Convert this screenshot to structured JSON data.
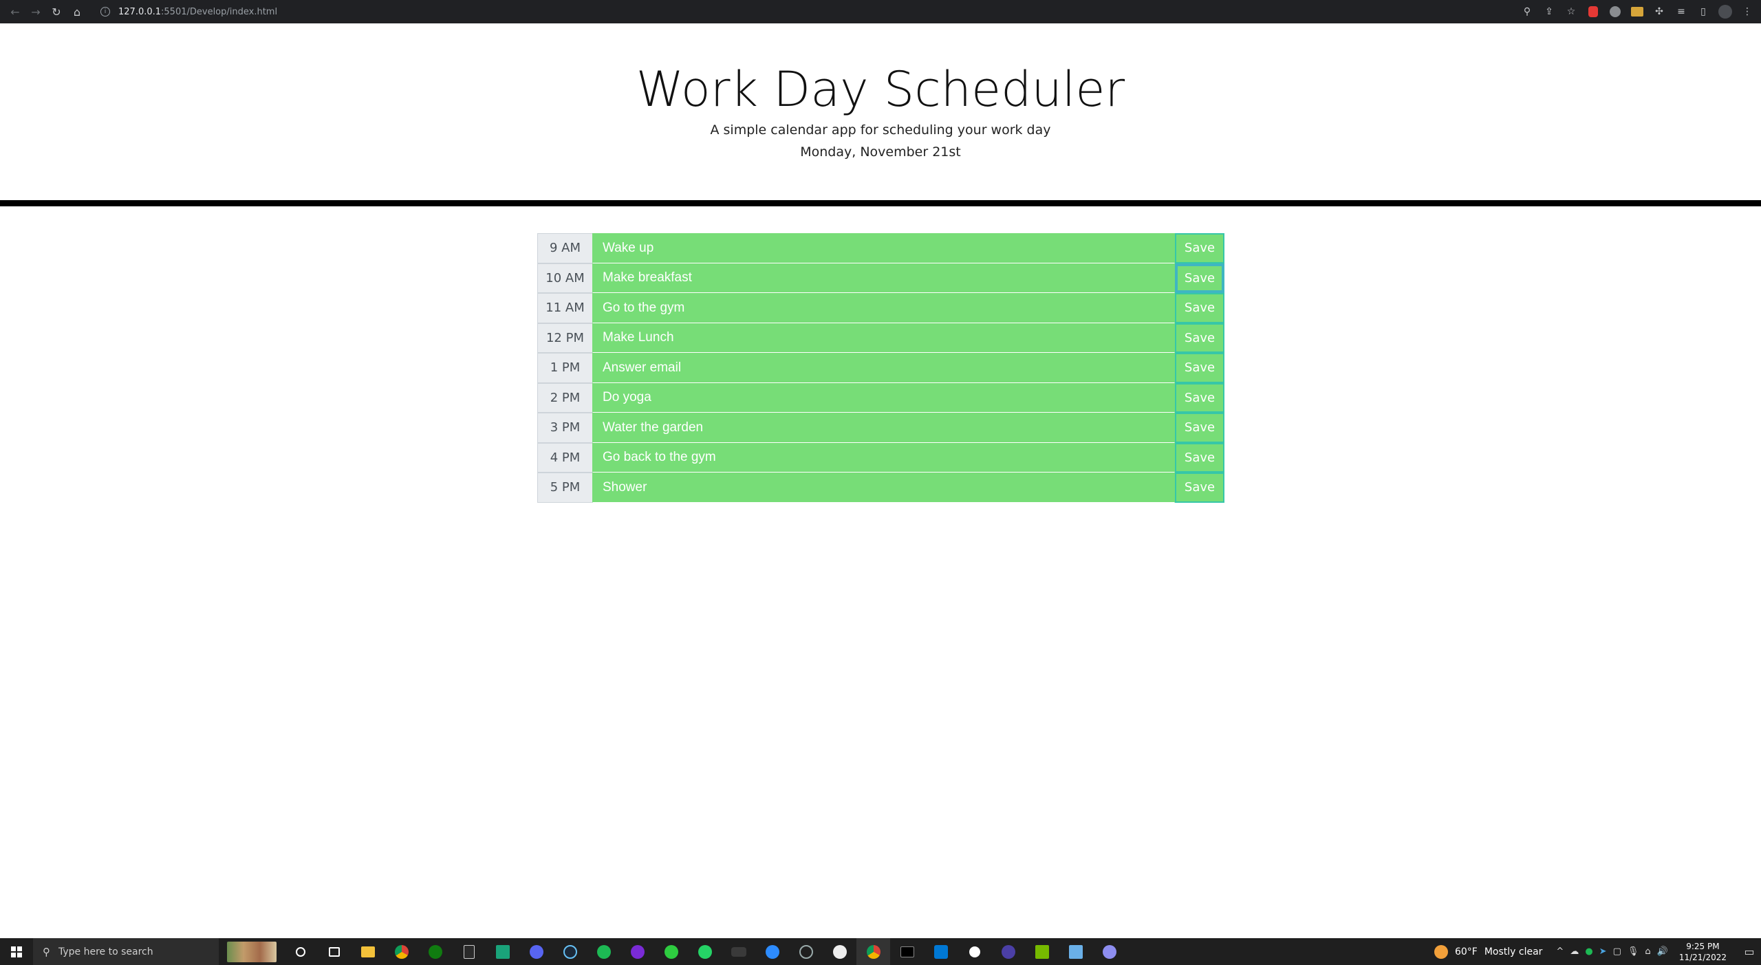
{
  "browser": {
    "url_host": "127.0.0.1",
    "url_rest": ":5501/Develop/index.html"
  },
  "header": {
    "title": "Work Day Scheduler",
    "lead": "A simple calendar app for scheduling your work day",
    "current_day": "Monday, November 21st"
  },
  "schedule": {
    "save_label": "Save",
    "rows": [
      {
        "hour": "9 AM",
        "task": "Wake up"
      },
      {
        "hour": "10 AM",
        "task": "Make breakfast"
      },
      {
        "hour": "11 AM",
        "task": "Go to the gym"
      },
      {
        "hour": "12 PM",
        "task": "Make Lunch"
      },
      {
        "hour": "1 PM",
        "task": "Answer email"
      },
      {
        "hour": "2 PM",
        "task": "Do yoga"
      },
      {
        "hour": "3 PM",
        "task": "Water the garden"
      },
      {
        "hour": "4 PM",
        "task": "Go back to the gym"
      },
      {
        "hour": "5 PM",
        "task": "Shower"
      }
    ]
  },
  "colors": {
    "future": "#77dd77",
    "save_border": "#36c7a8",
    "hour_bg": "#e9ecef"
  },
  "taskbar": {
    "search_placeholder": "Type here to search",
    "weather_temp": "60°F",
    "weather_desc": "Mostly clear",
    "time": "9:25 PM",
    "date": "11/21/2022"
  }
}
